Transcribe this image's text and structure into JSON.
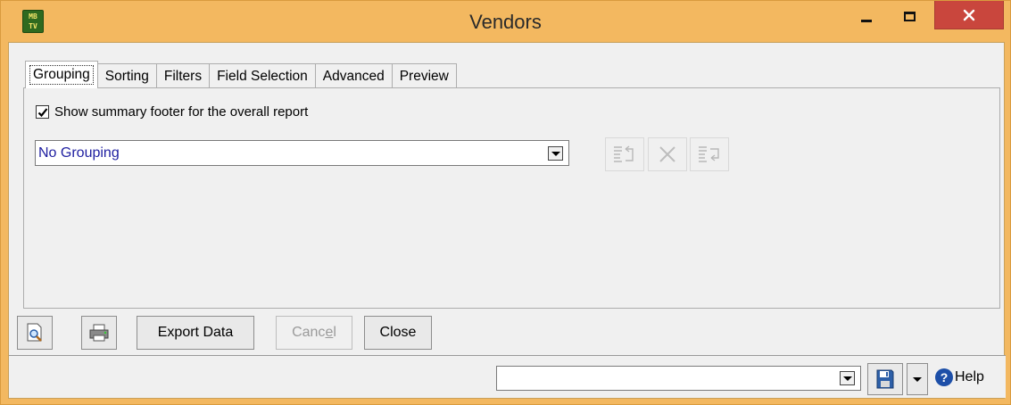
{
  "window": {
    "title": "Vendors",
    "app_icon_text_top": "MB",
    "app_icon_text_bottom": "TV",
    "accent_color": "#f3b860",
    "close_color": "#c9463d"
  },
  "tabs": [
    {
      "label": "Grouping",
      "active": true
    },
    {
      "label": "Sorting",
      "active": false
    },
    {
      "label": "Filters",
      "active": false
    },
    {
      "label": "Field Selection",
      "active": false
    },
    {
      "label": "Advanced",
      "active": false
    },
    {
      "label": "Preview",
      "active": false
    }
  ],
  "grouping": {
    "summary_footer_label": "Show summary footer for the overall report",
    "summary_footer_checked": true,
    "grouping_select_value": "No Grouping",
    "tool_icons": [
      "group-up-icon",
      "remove-icon",
      "group-down-icon"
    ]
  },
  "buttons": {
    "preview_icon": "print-preview-icon",
    "print_icon": "printer-icon",
    "export_label": "Export Data",
    "cancel_label_pre": "Canc",
    "cancel_label_ul": "e",
    "cancel_label_post": "l",
    "close_label": "Close"
  },
  "statusbar": {
    "report_select_value": "",
    "save_icon": "save-report-icon",
    "help_label": "Help"
  }
}
